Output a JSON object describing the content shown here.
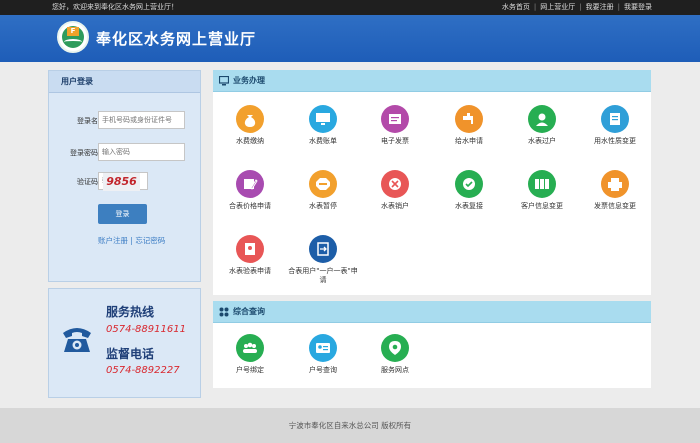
{
  "topbar": {
    "welcome": "您好，欢迎来到奉化区水务网上营业厅！",
    "links": [
      "水务首页",
      "网上营业厅",
      "我要注册",
      "我要登录"
    ]
  },
  "header": {
    "title": "奉化区水务网上营业厅"
  },
  "login": {
    "title": "用户登录",
    "username_label": "登录名：",
    "username_placeholder": "手机号码或身份证件号",
    "password_label": "登录密码：",
    "password_placeholder": "输入密码",
    "captcha_label": "验证码：",
    "captcha_placeholder": "验证码",
    "captcha_text": "9856",
    "submit_label": "登录",
    "register_label": "账户注册",
    "divider": "|",
    "forgot_label": "忘记密码"
  },
  "hotline": {
    "service_title": "服务热线",
    "service_number": "0574-88911611",
    "supervise_title": "监督电话",
    "supervise_number": "0574-8892227"
  },
  "business": {
    "title": "业务办理",
    "items": [
      {
        "label": "水费缴纳",
        "icon": "money-bag-icon",
        "color": "#f2a02d"
      },
      {
        "label": "水费账单",
        "icon": "monitor-icon",
        "color": "#29a8e0"
      },
      {
        "label": "电子发票",
        "icon": "invoice-icon",
        "color": "#b34aa9"
      },
      {
        "label": "给水申请",
        "icon": "tap-icon",
        "color": "#f0932b"
      },
      {
        "label": "水表过户",
        "icon": "transfer-icon",
        "color": "#27ae52"
      },
      {
        "label": "用水性质变更",
        "icon": "document-icon",
        "color": "#2f9fd8"
      },
      {
        "label": "合表价格申请",
        "icon": "edit-icon",
        "color": "#a84bb0"
      },
      {
        "label": "水表暂停",
        "icon": "stop-icon",
        "color": "#f2a02d"
      },
      {
        "label": "水表销户",
        "icon": "meter-cancel-icon",
        "color": "#e85656"
      },
      {
        "label": "水表复接",
        "icon": "meter-reconnect-icon",
        "color": "#27ae52"
      },
      {
        "label": "客户信息变更",
        "icon": "table-icon",
        "color": "#27ae52"
      },
      {
        "label": "发票信息变更",
        "icon": "printer-icon",
        "color": "#f0932b"
      },
      {
        "label": "水表验表申请",
        "icon": "report-icon",
        "color": "#e85656"
      },
      {
        "label": "合表用户\"一户一表\"申请",
        "icon": "convert-icon",
        "color": "#1d5ea8"
      }
    ]
  },
  "query": {
    "title": "综合查询",
    "items": [
      {
        "label": "户号绑定",
        "icon": "group-icon",
        "color": "#27ae52"
      },
      {
        "label": "户号查询",
        "icon": "id-card-icon",
        "color": "#29a8e0"
      },
      {
        "label": "服务网点",
        "icon": "location-icon",
        "color": "#27ae52"
      }
    ]
  },
  "footer": {
    "copyright": "宁波市奉化区自来水总公司 版权所有"
  }
}
